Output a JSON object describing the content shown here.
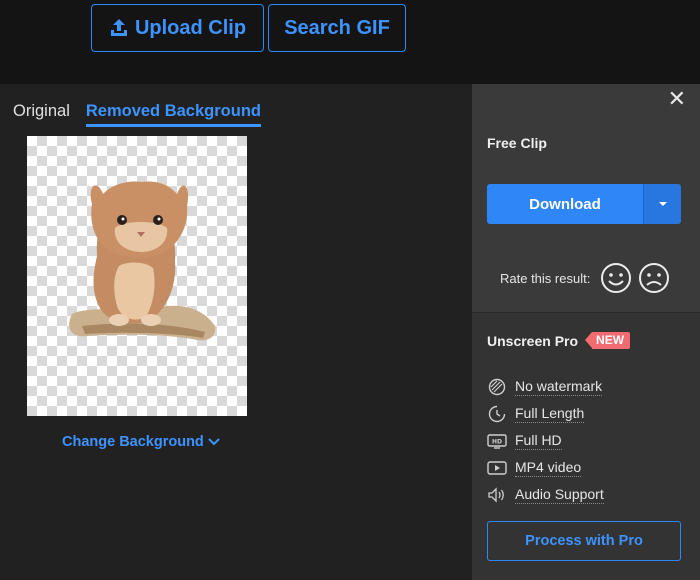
{
  "topbar": {
    "upload_label": "Upload Clip",
    "search_label": "Search GIF"
  },
  "tabs": {
    "original": "Original",
    "removed": "Removed Background"
  },
  "preview": {
    "change_background": "Change Background"
  },
  "sidebar": {
    "free_clip": "Free Clip",
    "download": "Download",
    "rate_label": "Rate this result:",
    "pro_name": "Unscreen Pro",
    "new_badge": "NEW",
    "features": [
      {
        "icon": "no-watermark-icon",
        "label": "No watermark"
      },
      {
        "icon": "clock-icon",
        "label": "Full Length"
      },
      {
        "icon": "hd-icon",
        "label": "Full HD"
      },
      {
        "icon": "play-icon",
        "label": "MP4 video"
      },
      {
        "icon": "speaker-icon",
        "label": "Audio Support"
      }
    ],
    "process_pro": "Process with Pro"
  },
  "colors": {
    "accent": "#2f86f6",
    "badge": "#f16b71"
  }
}
